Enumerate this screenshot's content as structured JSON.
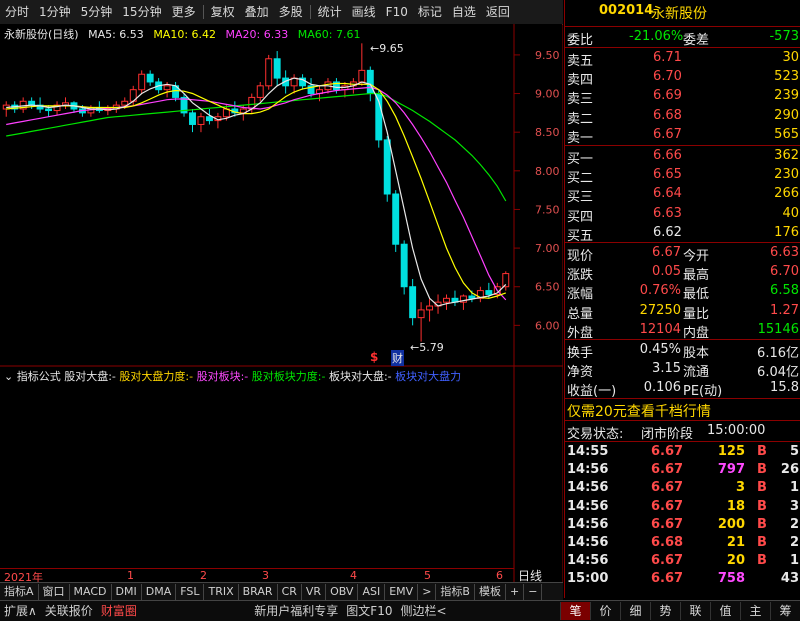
{
  "toolbar": {
    "items": [
      "分时",
      "1分钟",
      "5分钟",
      "15分钟",
      "更多",
      "复权",
      "叠加",
      "多股",
      "统计",
      "画线",
      "F10",
      "标记",
      "自选",
      "返回"
    ]
  },
  "chart": {
    "stock_title": "永新股份(日线)",
    "ma5": "MA5: 6.53",
    "ma10": "MA10: 6.42",
    "ma20": "MA20: 6.33",
    "ma60": "MA60: 7.61",
    "y_ticks": [
      "9.50",
      "9.00",
      "8.50",
      "8.00",
      "7.50",
      "7.00",
      "6.50",
      "6.00"
    ],
    "high_label": "9.65",
    "low_label": "5.79",
    "marker_s": "$",
    "marker_cai": "财",
    "date_labels": [
      "2021年",
      "1",
      "2",
      "3",
      "4",
      "5",
      "6"
    ],
    "ylabel_btn": "日线"
  },
  "chart_data": {
    "type": "candlestick",
    "ylim": [
      5.5,
      9.9
    ],
    "candles": [
      [
        8.8,
        8.9,
        8.7,
        8.85
      ],
      [
        8.85,
        8.9,
        8.75,
        8.8
      ],
      [
        8.8,
        8.95,
        8.75,
        8.9
      ],
      [
        8.9,
        8.95,
        8.8,
        8.85
      ],
      [
        8.85,
        8.95,
        8.75,
        8.8
      ],
      [
        8.8,
        8.85,
        8.7,
        8.78
      ],
      [
        8.78,
        8.9,
        8.72,
        8.85
      ],
      [
        8.85,
        8.95,
        8.8,
        8.88
      ],
      [
        8.88,
        8.9,
        8.75,
        8.8
      ],
      [
        8.8,
        8.85,
        8.7,
        8.75
      ],
      [
        8.75,
        8.85,
        8.7,
        8.82
      ],
      [
        8.82,
        8.9,
        8.75,
        8.78
      ],
      [
        8.78,
        8.85,
        8.72,
        8.8
      ],
      [
        8.8,
        8.9,
        8.75,
        8.85
      ],
      [
        8.85,
        8.95,
        8.8,
        8.9
      ],
      [
        8.9,
        9.1,
        8.85,
        9.05
      ],
      [
        9.05,
        9.3,
        9.0,
        9.25
      ],
      [
        9.25,
        9.3,
        9.1,
        9.15
      ],
      [
        9.15,
        9.2,
        9.0,
        9.05
      ],
      [
        9.05,
        9.15,
        8.95,
        9.1
      ],
      [
        9.1,
        9.15,
        8.9,
        8.95
      ],
      [
        8.95,
        9.0,
        8.7,
        8.75
      ],
      [
        8.75,
        8.8,
        8.5,
        8.6
      ],
      [
        8.6,
        8.75,
        8.5,
        8.7
      ],
      [
        8.7,
        8.8,
        8.6,
        8.65
      ],
      [
        8.65,
        8.75,
        8.55,
        8.7
      ],
      [
        8.7,
        8.85,
        8.65,
        8.8
      ],
      [
        8.8,
        8.9,
        8.7,
        8.75
      ],
      [
        8.75,
        8.85,
        8.65,
        8.8
      ],
      [
        8.8,
        9.0,
        8.75,
        8.95
      ],
      [
        8.95,
        9.15,
        8.9,
        9.1
      ],
      [
        9.1,
        9.5,
        9.05,
        9.45
      ],
      [
        9.45,
        9.55,
        9.1,
        9.2
      ],
      [
        9.2,
        9.3,
        9.0,
        9.1
      ],
      [
        9.1,
        9.25,
        9.0,
        9.2
      ],
      [
        9.2,
        9.25,
        9.05,
        9.1
      ],
      [
        9.1,
        9.2,
        8.95,
        9.0
      ],
      [
        9.0,
        9.1,
        8.9,
        9.05
      ],
      [
        9.05,
        9.2,
        9.0,
        9.15
      ],
      [
        9.15,
        9.2,
        9.0,
        9.05
      ],
      [
        9.05,
        9.15,
        8.95,
        9.1
      ],
      [
        9.1,
        9.2,
        9.0,
        9.15
      ],
      [
        9.15,
        9.65,
        9.1,
        9.3
      ],
      [
        9.3,
        9.35,
        8.9,
        9.0
      ],
      [
        9.0,
        9.05,
        8.3,
        8.4
      ],
      [
        8.4,
        8.45,
        7.6,
        7.7
      ],
      [
        7.7,
        7.75,
        6.95,
        7.05
      ],
      [
        7.05,
        7.1,
        6.4,
        6.5
      ],
      [
        6.5,
        6.6,
        6.0,
        6.1
      ],
      [
        6.1,
        6.3,
        5.79,
        6.2
      ],
      [
        6.2,
        6.35,
        6.05,
        6.25
      ],
      [
        6.25,
        6.4,
        6.15,
        6.3
      ],
      [
        6.3,
        6.4,
        6.2,
        6.35
      ],
      [
        6.35,
        6.45,
        6.25,
        6.3
      ],
      [
        6.3,
        6.4,
        6.2,
        6.38
      ],
      [
        6.38,
        6.45,
        6.3,
        6.35
      ],
      [
        6.35,
        6.5,
        6.3,
        6.45
      ],
      [
        6.45,
        6.55,
        6.35,
        6.4
      ],
      [
        6.4,
        6.55,
        6.35,
        6.5
      ],
      [
        6.5,
        6.7,
        6.45,
        6.67
      ]
    ],
    "ma5": [
      8.82,
      8.83,
      8.84,
      8.85,
      8.84,
      8.82,
      8.83,
      8.85,
      8.84,
      8.82,
      8.8,
      8.8,
      8.79,
      8.8,
      8.83,
      8.9,
      9.0,
      9.06,
      9.1,
      9.12,
      9.1,
      9.0,
      8.88,
      8.8,
      8.72,
      8.66,
      8.68,
      8.72,
      8.74,
      8.8,
      8.88,
      9.0,
      9.1,
      9.16,
      9.2,
      9.18,
      9.12,
      9.1,
      9.1,
      9.08,
      9.08,
      9.1,
      9.15,
      9.12,
      8.9,
      8.5,
      8.0,
      7.5,
      7.0,
      6.6,
      6.35,
      6.25,
      6.28,
      6.3,
      6.32,
      6.34,
      6.36,
      6.38,
      6.42,
      6.53
    ],
    "ma10": [
      8.8,
      8.81,
      8.82,
      8.83,
      8.84,
      8.84,
      8.84,
      8.84,
      8.84,
      8.83,
      8.82,
      8.82,
      8.82,
      8.82,
      8.82,
      8.84,
      8.88,
      8.93,
      8.98,
      9.02,
      9.04,
      9.03,
      9.0,
      8.95,
      8.9,
      8.85,
      8.8,
      8.76,
      8.74,
      8.74,
      8.76,
      8.8,
      8.88,
      8.96,
      9.02,
      9.06,
      9.08,
      9.1,
      9.12,
      9.13,
      9.13,
      9.12,
      9.12,
      9.12,
      9.05,
      8.9,
      8.7,
      8.45,
      8.18,
      7.9,
      7.6,
      7.3,
      7.0,
      6.75,
      6.55,
      6.42,
      6.36,
      6.35,
      6.38,
      6.42
    ],
    "ma20": [
      8.6,
      8.62,
      8.64,
      8.66,
      8.68,
      8.7,
      8.72,
      8.74,
      8.76,
      8.78,
      8.79,
      8.8,
      8.81,
      8.82,
      8.83,
      8.84,
      8.86,
      8.88,
      8.9,
      8.92,
      8.93,
      8.93,
      8.92,
      8.91,
      8.9,
      8.88,
      8.86,
      8.84,
      8.82,
      8.81,
      8.8,
      8.82,
      8.85,
      8.88,
      8.92,
      8.95,
      8.98,
      9.0,
      9.02,
      9.04,
      9.05,
      9.06,
      9.07,
      9.08,
      9.05,
      8.98,
      8.88,
      8.75,
      8.6,
      8.43,
      8.25,
      8.05,
      7.85,
      7.62,
      7.4,
      7.15,
      6.9,
      6.65,
      6.45,
      6.33
    ],
    "ma60": [
      8.45,
      8.47,
      8.49,
      8.51,
      8.53,
      8.55,
      8.57,
      8.59,
      8.61,
      8.63,
      8.65,
      8.67,
      8.69,
      8.7,
      8.71,
      8.72,
      8.73,
      8.74,
      8.75,
      8.76,
      8.77,
      8.78,
      8.79,
      8.8,
      8.81,
      8.82,
      8.83,
      8.84,
      8.85,
      8.86,
      8.87,
      8.88,
      8.89,
      8.9,
      8.91,
      8.92,
      8.93,
      8.94,
      8.95,
      8.96,
      8.97,
      8.98,
      8.99,
      9.0,
      9.0,
      8.96,
      8.9,
      8.84,
      8.78,
      8.71,
      8.64,
      8.56,
      8.48,
      8.4,
      8.3,
      8.2,
      8.08,
      7.95,
      7.8,
      7.61
    ]
  },
  "indicator": {
    "title": "指标公式",
    "items": [
      "股对大盘:-",
      "股对大盘力度:-",
      "股对板块:-",
      "股对板块力度:-",
      "板块对大盘:-",
      "板块对大盘力"
    ]
  },
  "tabs1": [
    "指标A",
    "窗口",
    "MACD",
    "DMI",
    "DMA",
    "FSL",
    "TRIX",
    "BRAR",
    "CR",
    "VR",
    "OBV",
    "ASI",
    "EMV",
    ">",
    "指标B",
    "模板",
    "+",
    "−"
  ],
  "tabs2_left": [
    "扩展∧",
    "关联报价",
    "财富圈"
  ],
  "tabs2_mid": [
    "新用户福利专享",
    "图文F10",
    "侧边栏<"
  ],
  "tabs2_right": [
    "笔",
    "价",
    "细",
    "势",
    "联",
    "值",
    "主",
    "筹"
  ],
  "quote": {
    "code": "002014",
    "name": "永新股份",
    "weibi_label": "委比",
    "weibi": "-21.06%",
    "weicha_label": "委差",
    "weicha": "-573",
    "sell": [
      {
        "label": "卖五",
        "price": "6.71",
        "vol": "30"
      },
      {
        "label": "卖四",
        "price": "6.70",
        "vol": "523"
      },
      {
        "label": "卖三",
        "price": "6.69",
        "vol": "239"
      },
      {
        "label": "卖二",
        "price": "6.68",
        "vol": "290"
      },
      {
        "label": "卖一",
        "price": "6.67",
        "vol": "565"
      }
    ],
    "buy": [
      {
        "label": "买一",
        "price": "6.66",
        "vol": "362"
      },
      {
        "label": "买二",
        "price": "6.65",
        "vol": "230"
      },
      {
        "label": "买三",
        "price": "6.64",
        "vol": "266"
      },
      {
        "label": "买四",
        "price": "6.63",
        "vol": "40"
      },
      {
        "label": "买五",
        "price": "6.62",
        "vol": "176"
      }
    ],
    "stats": [
      {
        "l1": "现价",
        "v1": "6.67",
        "l2": "今开",
        "v2": "6.63"
      },
      {
        "l1": "涨跌",
        "v1": "0.05",
        "l2": "最高",
        "v2": "6.70"
      },
      {
        "l1": "涨幅",
        "v1": "0.76%",
        "l2": "最低",
        "v2": "6.58"
      },
      {
        "l1": "总量",
        "v1": "27250",
        "l2": "量比",
        "v2": "1.27"
      },
      {
        "l1": "外盘",
        "v1": "12104",
        "l2": "内盘",
        "v2": "15146"
      }
    ],
    "stats2": [
      {
        "l1": "换手",
        "v1": "0.45%",
        "l2": "股本",
        "v2": "6.16亿"
      },
      {
        "l1": "净资",
        "v1": "3.15",
        "l2": "流通",
        "v2": "6.04亿"
      },
      {
        "l1": "收益(一)",
        "v1": "0.106",
        "l2": "PE(动)",
        "v2": "15.8"
      }
    ],
    "promo": "仅需20元查看千档行情",
    "status_label": "交易状态:",
    "status": "闭市阶段",
    "status_time": "15:00:00",
    "ticks": [
      {
        "t": "14:55",
        "p": "6.67",
        "v": "125",
        "s": "B",
        "n": "5"
      },
      {
        "t": "14:56",
        "p": "6.67",
        "v": "797",
        "s": "B",
        "n": "26"
      },
      {
        "t": "14:56",
        "p": "6.67",
        "v": "3",
        "s": "B",
        "n": "1"
      },
      {
        "t": "14:56",
        "p": "6.67",
        "v": "18",
        "s": "B",
        "n": "3"
      },
      {
        "t": "14:56",
        "p": "6.67",
        "v": "200",
        "s": "B",
        "n": "2"
      },
      {
        "t": "14:56",
        "p": "6.68",
        "v": "21",
        "s": "B",
        "n": "2"
      },
      {
        "t": "14:56",
        "p": "6.67",
        "v": "20",
        "s": "B",
        "n": "1"
      },
      {
        "t": "15:00",
        "p": "6.67",
        "v": "758",
        "s": "",
        "n": "43"
      }
    ]
  }
}
